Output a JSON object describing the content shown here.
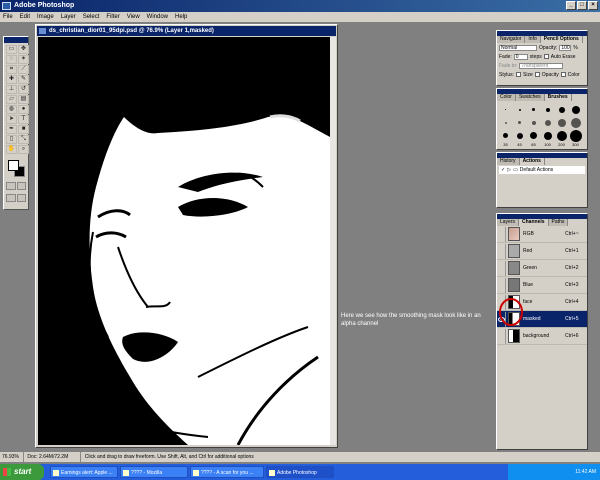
{
  "app": {
    "title": "Adobe Photoshop"
  },
  "menu": [
    "File",
    "Edit",
    "Image",
    "Layer",
    "Select",
    "Filter",
    "View",
    "Window",
    "Help"
  ],
  "document": {
    "title": "ds_christian_dior01_95dpi.psd @ 76.9% (Layer 1,masked)"
  },
  "options_palette": {
    "tabs": [
      "Navigator",
      "Info",
      "Pencil Options"
    ],
    "mode": "Normal",
    "opacity_label": "Opacity:",
    "opacity_value": "100",
    "opacity_unit": "%",
    "fade_label": "Fade:",
    "fade_value": "0",
    "steps_label": "steps",
    "auto_erase_label": "Auto Erase",
    "fade_to_label": "Fade to:",
    "fade_to_value": "Transparent",
    "stylus_label": "Stylus:",
    "size_label": "Size",
    "opacity_chk_label": "Opacity",
    "color_chk_label": "Color"
  },
  "brushes_palette": {
    "tabs": [
      "Color",
      "Swatches",
      "Brushes"
    ],
    "labels": [
      "35",
      "45",
      "65",
      "100",
      "200",
      "300"
    ]
  },
  "history_palette": {
    "tabs": [
      "History",
      "Actions"
    ],
    "item": "Default Actions"
  },
  "layers_palette": {
    "tabs": [
      "Layers",
      "Channels",
      "Paths"
    ],
    "channels": [
      {
        "name": "RGB",
        "key": "Ctrl+~"
      },
      {
        "name": "Red",
        "key": "Ctrl+1"
      },
      {
        "name": "Green",
        "key": "Ctrl+2"
      },
      {
        "name": "Blue",
        "key": "Ctrl+3"
      },
      {
        "name": "face",
        "key": "Ctrl+4"
      },
      {
        "name": "masked",
        "key": "Ctrl+5"
      },
      {
        "name": "background",
        "key": "Ctrl+6"
      }
    ]
  },
  "annotation": "Here we see how the smoothing mask look like in an alpha channel",
  "status": {
    "zoom": "76.93%",
    "doc": "Doc: 2.64M/72.2M",
    "hint": "Click and drag to draw freeform. Use Shift, Alt, and Ctrl for additional options"
  },
  "taskbar": {
    "start": "start",
    "tasks": [
      "Earnings alert: Apple ...",
      "???? - Mozilla",
      "???? - A scan for you ...",
      "Adobe Photoshop"
    ],
    "clock": "11:42 AM"
  }
}
